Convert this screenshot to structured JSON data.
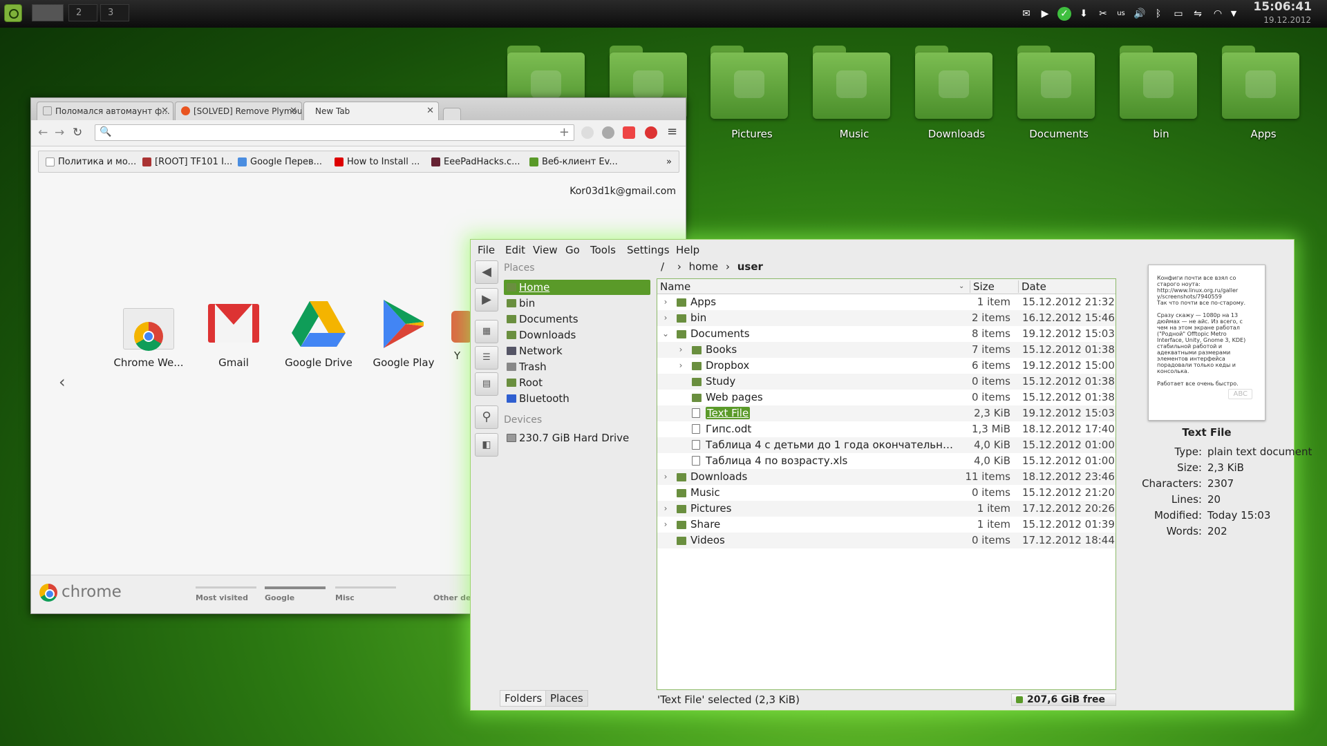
{
  "panel": {
    "workspaces": [
      "",
      "2",
      "3"
    ],
    "clock_time": "15:06:41",
    "clock_date": "19.12.2012",
    "kbd_layout": "us"
  },
  "desktop": {
    "folders": [
      "",
      "",
      "Pictures",
      "Music",
      "Downloads",
      "Documents",
      "bin",
      "Apps"
    ]
  },
  "chrome": {
    "tabs": [
      "Поломался автомаунт ф...",
      "[SOLVED] Remove Plymou...",
      "New Tab"
    ],
    "bookmarks": [
      "Политика и мо...",
      "[ROOT] TF101 I...",
      "Google Перев...",
      "How to Install ...",
      "EeePadHacks.c...",
      "Веб-клиент Ev..."
    ],
    "bookmarks_more": "»",
    "user_email": "Kor03d1k@gmail.com",
    "apps": [
      "Chrome We...",
      "Gmail",
      "Google Drive",
      "Google Play",
      "Y"
    ],
    "brand": "chrome",
    "footer_sections": [
      "Most visited",
      "Google",
      "Misc",
      "Other de"
    ]
  },
  "fm": {
    "menu": [
      "File",
      "Edit",
      "View",
      "Go",
      "Tools",
      "Settings",
      "Help"
    ],
    "places_header": "Places",
    "places": [
      "Home",
      "bin",
      "Documents",
      "Downloads",
      "Network",
      "Trash",
      "Root",
      "Bluetooth"
    ],
    "devices_header": "Devices",
    "devices": [
      "230.7 GiB Hard Drive"
    ],
    "crumbs": {
      "root": "/",
      "home": "home",
      "user": "user"
    },
    "columns": {
      "name": "Name",
      "size": "Size",
      "date": "Date"
    },
    "rows": [
      {
        "name": "Apps",
        "size": "1 item",
        "date": "15.12.2012 21:32",
        "level": 0,
        "type": "folder",
        "exp": "›"
      },
      {
        "name": "bin",
        "size": "2 items",
        "date": "16.12.2012 15:46",
        "level": 0,
        "type": "folder",
        "exp": "›"
      },
      {
        "name": "Documents",
        "size": "8 items",
        "date": "19.12.2012 15:03",
        "level": 0,
        "type": "folder",
        "exp": "⌄"
      },
      {
        "name": "Books",
        "size": "7 items",
        "date": "15.12.2012 01:38",
        "level": 1,
        "type": "folder",
        "exp": "›"
      },
      {
        "name": "Dropbox",
        "size": "6 items",
        "date": "19.12.2012 15:00",
        "level": 1,
        "type": "folder",
        "exp": "›"
      },
      {
        "name": "Study",
        "size": "0 items",
        "date": "15.12.2012 01:38",
        "level": 1,
        "type": "folder",
        "exp": ""
      },
      {
        "name": "Web pages",
        "size": "0 items",
        "date": "15.12.2012 01:38",
        "level": 1,
        "type": "folder",
        "exp": ""
      },
      {
        "name": "Text File",
        "size": "2,3 KiB",
        "date": "19.12.2012 15:03",
        "level": 1,
        "type": "file",
        "exp": "",
        "selected": true
      },
      {
        "name": "Гипс.odt",
        "size": "1,3 MiB",
        "date": "18.12.2012 17:40",
        "level": 1,
        "type": "file",
        "exp": ""
      },
      {
        "name": "Таблица   4 с детьми до 1 года окончательная ...",
        "size": "4,0 KiB",
        "date": "15.12.2012 01:00",
        "level": 1,
        "type": "file",
        "exp": ""
      },
      {
        "name": "Таблица 4 по возрасту.xls",
        "size": "4,0 KiB",
        "date": "15.12.2012 01:00",
        "level": 1,
        "type": "file",
        "exp": ""
      },
      {
        "name": "Downloads",
        "size": "11 items",
        "date": "18.12.2012 23:46",
        "level": 0,
        "type": "folder",
        "exp": "›"
      },
      {
        "name": "Music",
        "size": "0 items",
        "date": "15.12.2012 21:20",
        "level": 0,
        "type": "folder",
        "exp": ""
      },
      {
        "name": "Pictures",
        "size": "1 item",
        "date": "17.12.2012 20:26",
        "level": 0,
        "type": "folder",
        "exp": "›"
      },
      {
        "name": "Share",
        "size": "1 item",
        "date": "15.12.2012 01:39",
        "level": 0,
        "type": "folder",
        "exp": "›"
      },
      {
        "name": "Videos",
        "size": "0 items",
        "date": "17.12.2012 18:44",
        "level": 0,
        "type": "folder",
        "exp": ""
      }
    ],
    "preview_text": "Конфиги почти все взял со\nстарого ноута:\nhttp://www.linux.org.ru/galler\ny/screenshots/7940559\nТак что почти все по-старому.\n\nСразу скажу — 1080p на 13\nдюймах — не айс. Из всего, с\nчем на этом экране работал\n(\"Родной\" Offtopic Metro\nInterface, Unity, Gnome 3, KDE)\nстабильной работой и\nадекватными размерами\nэлементов интерфейса\nпорадовали только кеды и\nконсолька.\n\nРаботает все очень быстро.",
    "preview_badge": "ABC",
    "props_title": "Text File",
    "props": [
      [
        "Type:",
        "plain text document"
      ],
      [
        "Size:",
        "2,3 KiB"
      ],
      [
        "Characters:",
        "2307"
      ],
      [
        "Lines:",
        "20"
      ],
      [
        "Modified:",
        "Today 15:03"
      ],
      [
        "Words:",
        "202"
      ]
    ],
    "bottom_tabs": [
      "Folders",
      "Places"
    ],
    "status": "'Text File' selected (2,3 KiB)",
    "free": "207,6 GiB free"
  },
  "colors": {
    "accent": "#5a9a29",
    "folder": "#6a8f3f",
    "glow": "#8cff50"
  }
}
